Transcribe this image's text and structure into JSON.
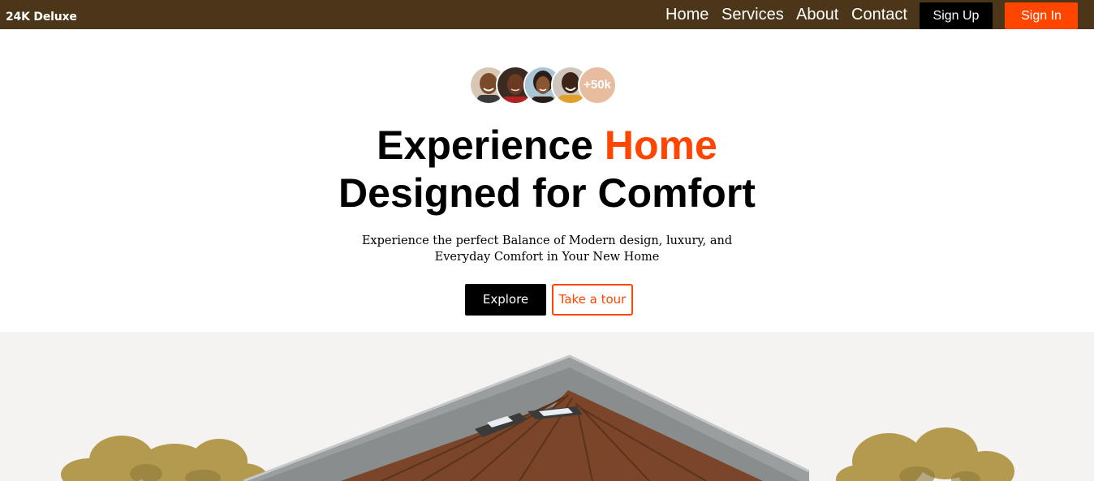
{
  "brand": {
    "name": "24K Deluxe"
  },
  "nav": {
    "links": [
      "Home",
      "Services",
      "About",
      "Contact"
    ],
    "signup_label": "Sign Up",
    "signin_label": "Sign In"
  },
  "social_proof": {
    "avatars": [
      "customer-avatar-1",
      "customer-avatar-2",
      "customer-avatar-3",
      "customer-avatar-4"
    ],
    "more_count": "+50k"
  },
  "hero": {
    "headline_prefix": "Experience ",
    "headline_accent": "Home",
    "headline_line2": "Designed for Comfort",
    "subtitle_line1": "Experience the perfect Balance of Modern design, luxury, and",
    "subtitle_line2": "Everyday Comfort in Your New Home",
    "explore_label": "Explore",
    "tour_label": "Take a tour"
  },
  "colors": {
    "navbar": "#4b3619",
    "accent": "#ff4500",
    "primary_button": "#000000",
    "avatar_more_bg": "#e7bc9f"
  },
  "icons": [
    "house-photo"
  ]
}
